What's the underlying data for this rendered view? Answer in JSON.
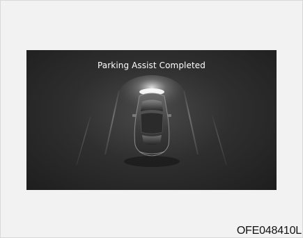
{
  "screen": {
    "message": "Parking Assist Completed",
    "icon": "car-top-view-icon"
  },
  "figure": {
    "code": "OFE048410L"
  },
  "colors": {
    "screen_background": "#2f2f2f",
    "message_text": "#ffffff",
    "page_background": "#f2f2f2"
  }
}
